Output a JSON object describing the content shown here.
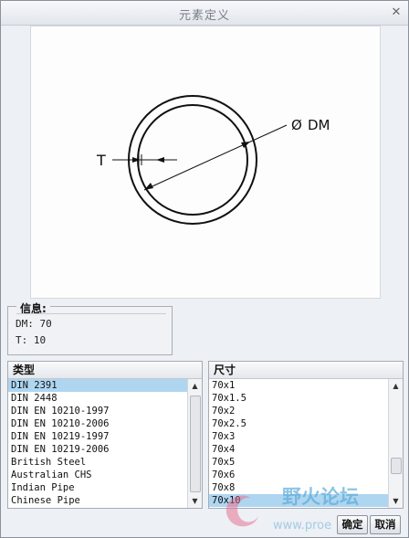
{
  "window": {
    "title": "元素定义"
  },
  "diagram": {
    "thickness_label": "T",
    "diameter_label": "DM",
    "diameter_symbol": "Ø"
  },
  "info": {
    "title": "信息:",
    "dm_line": "DM: 70",
    "t_line": "T: 10"
  },
  "types_list": {
    "header": "类型",
    "items": [
      "DIN 2391",
      "DIN 2448",
      "DIN EN 10210-1997",
      "DIN EN 10210-2006",
      "DIN EN 10219-1997",
      "DIN EN 10219-2006",
      "British Steel",
      "Australian CHS",
      "Indian Pipe",
      "Chinese Pipe"
    ],
    "selected_index": 0
  },
  "size_list": {
    "header": "尺寸",
    "items": [
      "70x1",
      "70x1.5",
      "70x2",
      "70x2.5",
      "70x3",
      "70x4",
      "70x5",
      "70x6",
      "70x8",
      "70x10"
    ],
    "selected_index": 9
  },
  "buttons": {
    "ok": "确定",
    "cancel": "取消"
  },
  "watermark": {
    "text": "野火论坛",
    "url_text": "www.proe"
  },
  "colors": {
    "selection": "#aed6f1",
    "watermark_text": "#5aa9d6"
  }
}
